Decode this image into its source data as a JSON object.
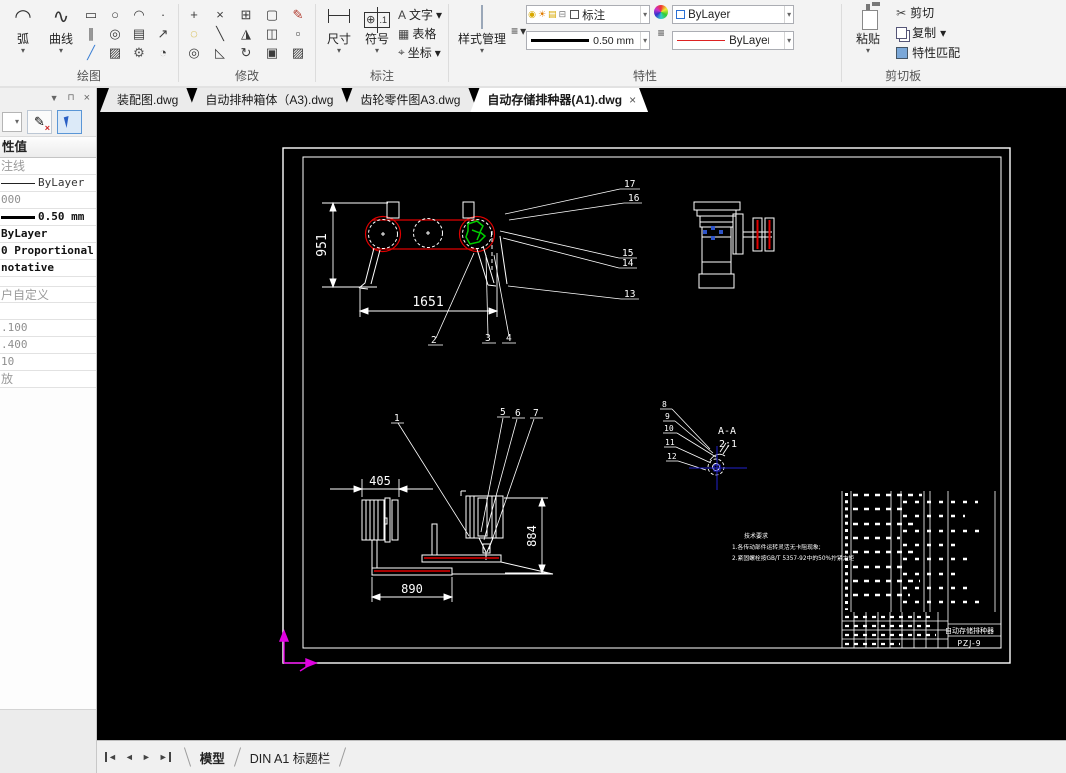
{
  "ribbon": {
    "glyphs": {
      "dropdown": "▾",
      "arc": "◠",
      "curve": "∿",
      "draw": [
        "▭",
        "○",
        "◠",
        "·",
        "∥",
        "◎",
        "▤",
        "↗",
        "╱",
        "▨",
        "⚙",
        "◔"
      ],
      "modify": [
        "+",
        "×",
        "⊞",
        "▢",
        "✎",
        "◌",
        "╲",
        "◮",
        "◫",
        "▫",
        "◎",
        "◺",
        "↻",
        "▣",
        "▨"
      ],
      "symbol_main": "⊕",
      "symbol_sub": ".1",
      "text_tool": "A",
      "table_tool": "▦",
      "coord_tool": "⌖",
      "menu": "≡",
      "bulb": "◉",
      "sun": "☀",
      "lock": "▤",
      "printer": "⊟",
      "cut": "✂",
      "pin": "⊓",
      "panel_chevron": "▼",
      "panel_close": "×",
      "nav_prev": "◄",
      "nav_next": "►"
    },
    "draw": {
      "label": "绘图",
      "arc": "弧",
      "curve": "曲线"
    },
    "modify": {
      "label": "修改"
    },
    "annotate": {
      "label": "标注",
      "dim": "尺寸",
      "symbol": "符号",
      "text": "文字",
      "table": "表格",
      "coord": "坐标"
    },
    "properties": {
      "label": "特性",
      "style_manager": "样式管理",
      "layer": "标注",
      "lineweight": "0.50 mm",
      "color": "ByLayer",
      "linetype": "ByLayer"
    },
    "clipboard": {
      "label": "剪切板",
      "paste": "粘贴",
      "cut": "剪切",
      "copy": "复制",
      "match": "特性匹配"
    }
  },
  "doc_tabs": {
    "items": [
      {
        "label": "装配图.dwg"
      },
      {
        "label": "自动排种箱体（A3).dwg"
      },
      {
        "label": "齿轮零件图A3.dwg"
      },
      {
        "label": "自动存储排种器(A1).dwg"
      }
    ],
    "close": "×"
  },
  "sidebar": {
    "header": "性值",
    "rows": [
      {
        "text": "注线"
      },
      {
        "text": "ByLayer"
      },
      {
        "text": "000"
      },
      {
        "text": "0.50 mm"
      },
      {
        "text": "ByLayer"
      },
      {
        "text": "0 Proportional"
      },
      {
        "text": "notative"
      },
      {
        "text": "户自定义"
      },
      {
        "text": ""
      },
      {
        "text": ".100"
      },
      {
        "text": ".400"
      },
      {
        "text": "10"
      },
      {
        "text": "放"
      }
    ]
  },
  "drawing": {
    "belt_view": {
      "dim_height": "951",
      "dim_width": "1651",
      "labels_right": [
        "17",
        "16",
        "15",
        "14",
        "13"
      ],
      "labels_bottom": [
        "2",
        "3",
        "4"
      ]
    },
    "planter_view": {
      "dim_top": "405",
      "dim_bottom": "890",
      "dim_right": "884",
      "labels": [
        "1",
        "5",
        "6",
        "7"
      ]
    },
    "section_view": {
      "name": "A-A",
      "scale": "2:1",
      "labels": [
        "8",
        "9",
        "10",
        "11",
        "12"
      ]
    },
    "notes": {
      "title": "技术要求",
      "line1": "1.各传动部件运转灵活无卡阻现象;",
      "line2": "2.紧固螺栓按GB/T 5357-92中的50%拧紧力矩"
    },
    "title_block": {
      "title": "自动存储排种器",
      "drawing_no": "PZJ-9"
    }
  },
  "model_bar": {
    "tabs": [
      {
        "label": "模型"
      },
      {
        "label": "DIN A1 标题栏"
      }
    ]
  }
}
